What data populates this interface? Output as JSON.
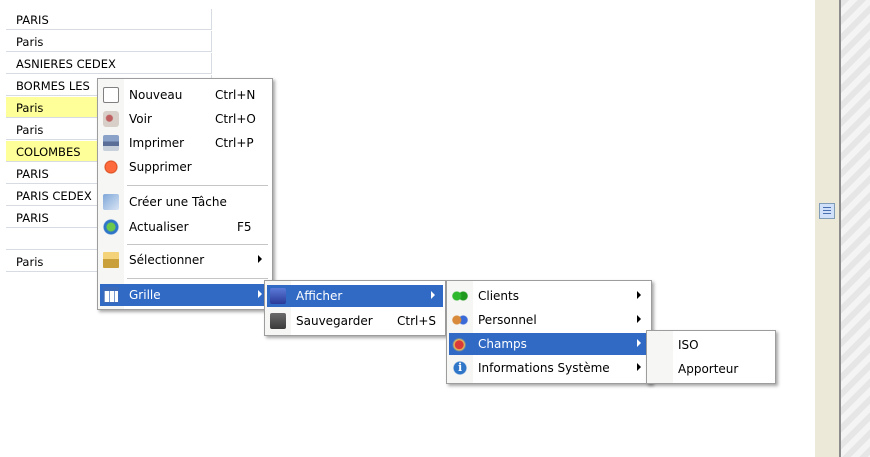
{
  "grid": {
    "rows": [
      {
        "text": "PARIS",
        "highlight": false
      },
      {
        "text": "Paris",
        "highlight": false
      },
      {
        "text": "ASNIERES CEDEX",
        "highlight": false
      },
      {
        "text": "BORMES LES",
        "highlight": false
      },
      {
        "text": "Paris",
        "highlight": true
      },
      {
        "text": "Paris",
        "highlight": false
      },
      {
        "text": "COLOMBES",
        "highlight": true
      },
      {
        "text": "PARIS",
        "highlight": false
      },
      {
        "text": "PARIS CEDEX",
        "highlight": false
      },
      {
        "text": "PARIS",
        "highlight": false
      },
      {
        "text": "",
        "highlight": false
      },
      {
        "text": "Paris",
        "highlight": false
      }
    ]
  },
  "context_menu": {
    "items": [
      {
        "label": "Nouveau",
        "shortcut": "Ctrl+N",
        "icon": "new-document-icon"
      },
      {
        "label": "Voir",
        "shortcut": "Ctrl+O",
        "icon": "view-icon"
      },
      {
        "label": "Imprimer",
        "shortcut": "Ctrl+P",
        "icon": "printer-icon"
      },
      {
        "label": "Supprimer",
        "shortcut": "",
        "icon": "delete-icon"
      },
      {
        "label": "Créer une Tâche",
        "shortcut": "",
        "icon": "task-icon"
      },
      {
        "label": "Actualiser",
        "shortcut": "F5",
        "icon": "refresh-icon"
      },
      {
        "label": "Sélectionner",
        "shortcut": "",
        "icon": "select-icon",
        "submenu": true
      },
      {
        "label": "Grille",
        "shortcut": "",
        "icon": "grid-icon",
        "submenu": true,
        "selected": true
      }
    ]
  },
  "grille_menu": {
    "items": [
      {
        "label": "Afficher",
        "shortcut": "",
        "icon": "display-icon",
        "submenu": true,
        "selected": true
      },
      {
        "label": "Sauvegarder",
        "shortcut": "Ctrl+S",
        "icon": "save-icon"
      }
    ]
  },
  "afficher_menu": {
    "items": [
      {
        "label": "Clients",
        "icon": "clients-icon",
        "submenu": true
      },
      {
        "label": "Personnel",
        "icon": "staff-icon",
        "submenu": true
      },
      {
        "label": "Champs",
        "icon": "fields-icon",
        "submenu": true,
        "selected": true
      },
      {
        "label": "Informations Système",
        "icon": "info-icon",
        "submenu": true
      }
    ]
  },
  "champs_menu": {
    "items": [
      {
        "label": "ISO"
      },
      {
        "label": "Apporteur"
      }
    ]
  },
  "colors": {
    "selection": "#316ac5",
    "highlight_row": "#ffff99",
    "menu_border": "#9d9d9d"
  }
}
